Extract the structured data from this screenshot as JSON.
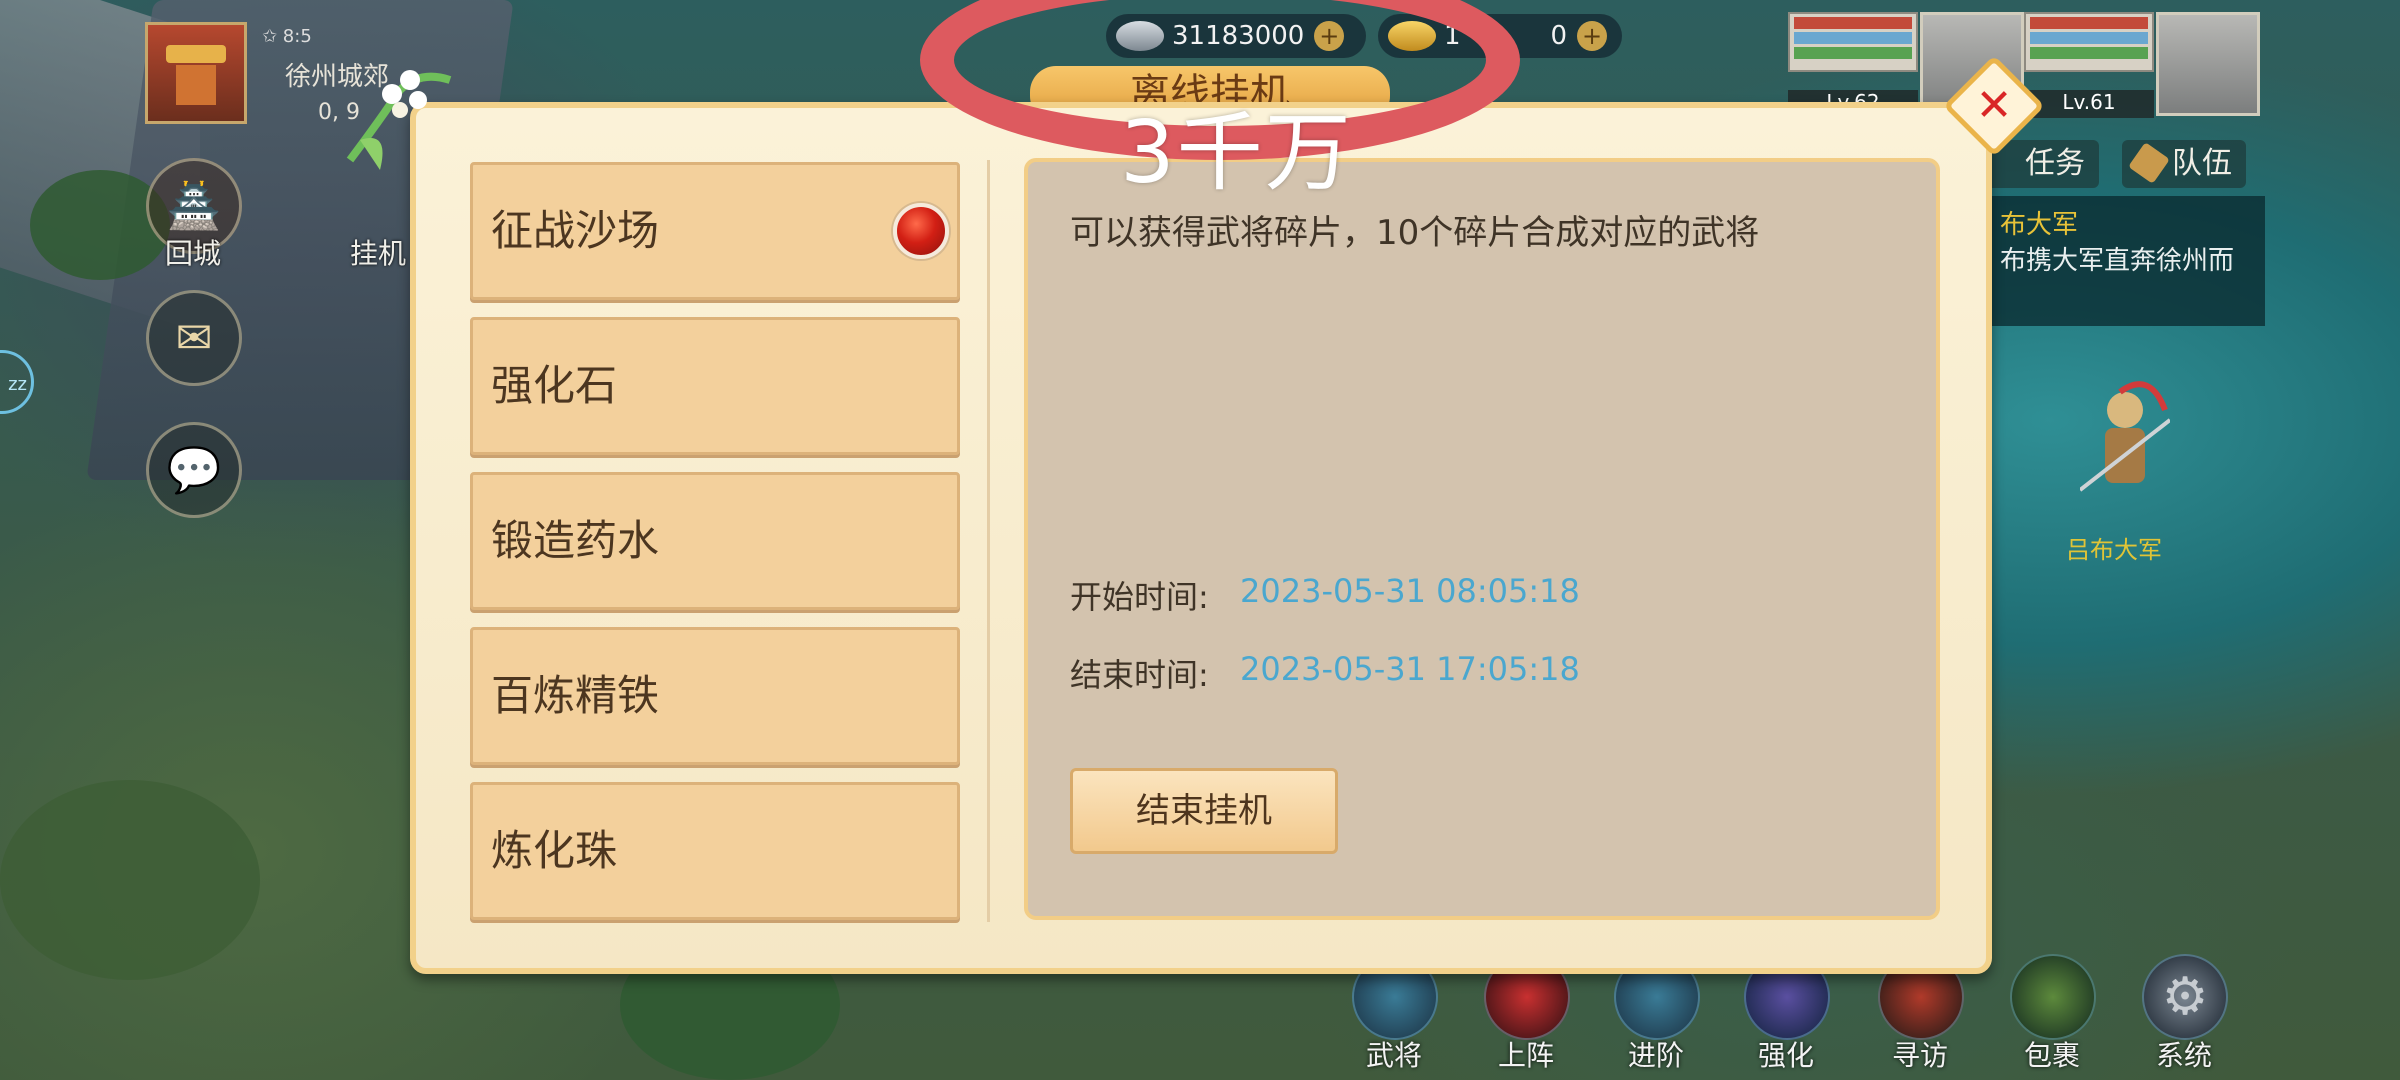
{
  "hud": {
    "silver": "31183000",
    "gold": "1",
    "gold_tail": "0",
    "annotation": "3千万",
    "title_fragment": "离线挂机",
    "city_stars": "✩ 8:5",
    "city_name": "徐州城郊",
    "city_coords": "0, 9"
  },
  "side": {
    "return_city": "回城",
    "idle": "挂机"
  },
  "team": [
    {
      "level": "Lv.62"
    },
    {
      "level": "Lv.61"
    }
  ],
  "tabs": {
    "tasks": "任务",
    "team": "队伍"
  },
  "quest": {
    "title": "布大军",
    "desc": "布携大军直奔徐州而"
  },
  "enemy": {
    "label": "吕布大军"
  },
  "modal": {
    "menu": [
      {
        "label": "征战沙场",
        "has_notification": true
      },
      {
        "label": "强化石"
      },
      {
        "label": "锻造药水"
      },
      {
        "label": "百炼精铁"
      },
      {
        "label": "炼化珠"
      }
    ],
    "description": "可以获得武将碎片，10个碎片合成对应的武将",
    "start_label": "开始时间:",
    "start_value": "2023-05-31 08:05:18",
    "end_label": "结束时间:",
    "end_value": "2023-05-31 17:05:18",
    "end_button": "结束挂机"
  },
  "actions": [
    "武将",
    "上阵",
    "进阶",
    "强化",
    "寻访",
    "包裹",
    "系统"
  ],
  "colors": {
    "annotation_ring": "#dd5a5f",
    "time_value": "#4aa7cf",
    "menu_bg": "#f3d09c"
  }
}
